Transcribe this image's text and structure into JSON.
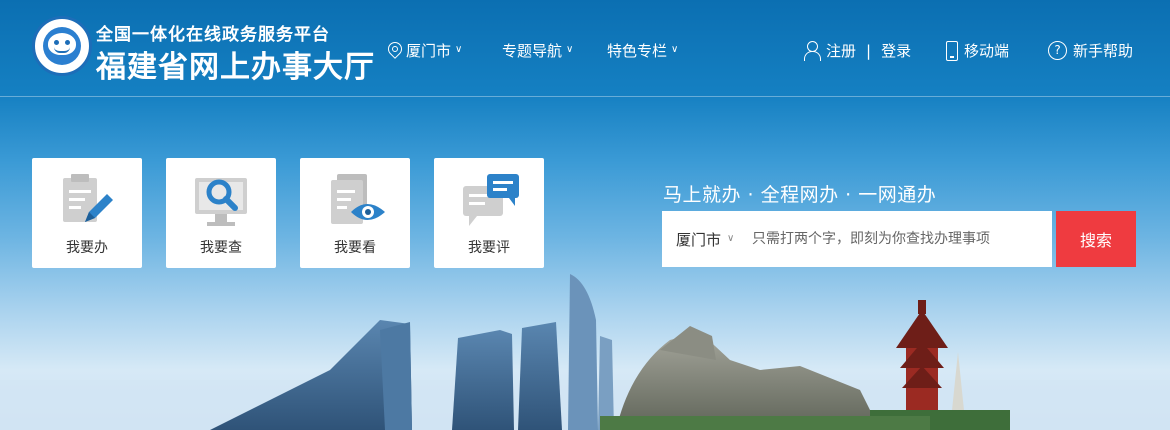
{
  "header": {
    "subtitle": "全国一体化在线政务服务平台",
    "title": "福建省网上办事大厅",
    "nav": {
      "city": "厦门市",
      "topics": "专题导航",
      "featured": "特色专栏"
    },
    "account": {
      "register": "注册",
      "separator": "|",
      "login": "登录"
    },
    "mobile": "移动端",
    "help": "新手帮助"
  },
  "tiles": [
    {
      "label": "我要办",
      "icon": "clipboard-pen-icon"
    },
    {
      "label": "我要查",
      "icon": "monitor-search-icon"
    },
    {
      "label": "我要看",
      "icon": "document-eye-icon"
    },
    {
      "label": "我要评",
      "icon": "comment-icon"
    }
  ],
  "search": {
    "slogan": "马上就办 · 全程网办 · 一网通办",
    "city": "厦门市",
    "placeholder": "只需打两个字，即刻为你查找办理事项",
    "button": "搜索"
  },
  "colors": {
    "header_blue": "#0b6fb2",
    "search_button": "#ef3b40",
    "icon_gray": "#cfcfcf",
    "icon_blue": "#2c82c9"
  }
}
